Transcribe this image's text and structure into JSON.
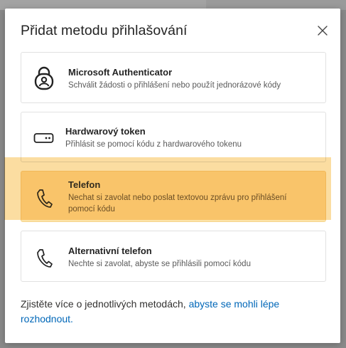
{
  "dialog": {
    "title": "Přidat metodu přihlašování",
    "close_label": "Zavřít"
  },
  "methods": [
    {
      "name": "Microsoft Authenticator",
      "description": "Schválit žádosti o přihlášení nebo použít jednorázové kódy",
      "icon": "authenticator-lock-icon"
    },
    {
      "name": "Hardwarový token",
      "description": "Přihlásit se pomocí kódu z hardwarového tokenu",
      "icon": "hardware-token-icon"
    },
    {
      "name": "Telefon",
      "description_line1": "Nechat si zavolat nebo poslat textovou zprávu pro přihlášení",
      "description_line2": "pomocí kódu",
      "icon": "phone-icon",
      "highlighted": true,
      "highlight_color": "#fbd791"
    },
    {
      "name": "Alternativní telefon",
      "description": "Nechte si zavolat, abyste se přihlásili pomocí kódu",
      "icon": "phone-icon"
    }
  ],
  "footer": {
    "text": "Zjistěte více o jednotlivých metodách, ",
    "link_line1": "abyste se mohli lépe",
    "link_line2": "rozhodnout."
  },
  "colors": {
    "link": "#0067b8",
    "highlight": "#fbd791",
    "title": "#242424"
  }
}
